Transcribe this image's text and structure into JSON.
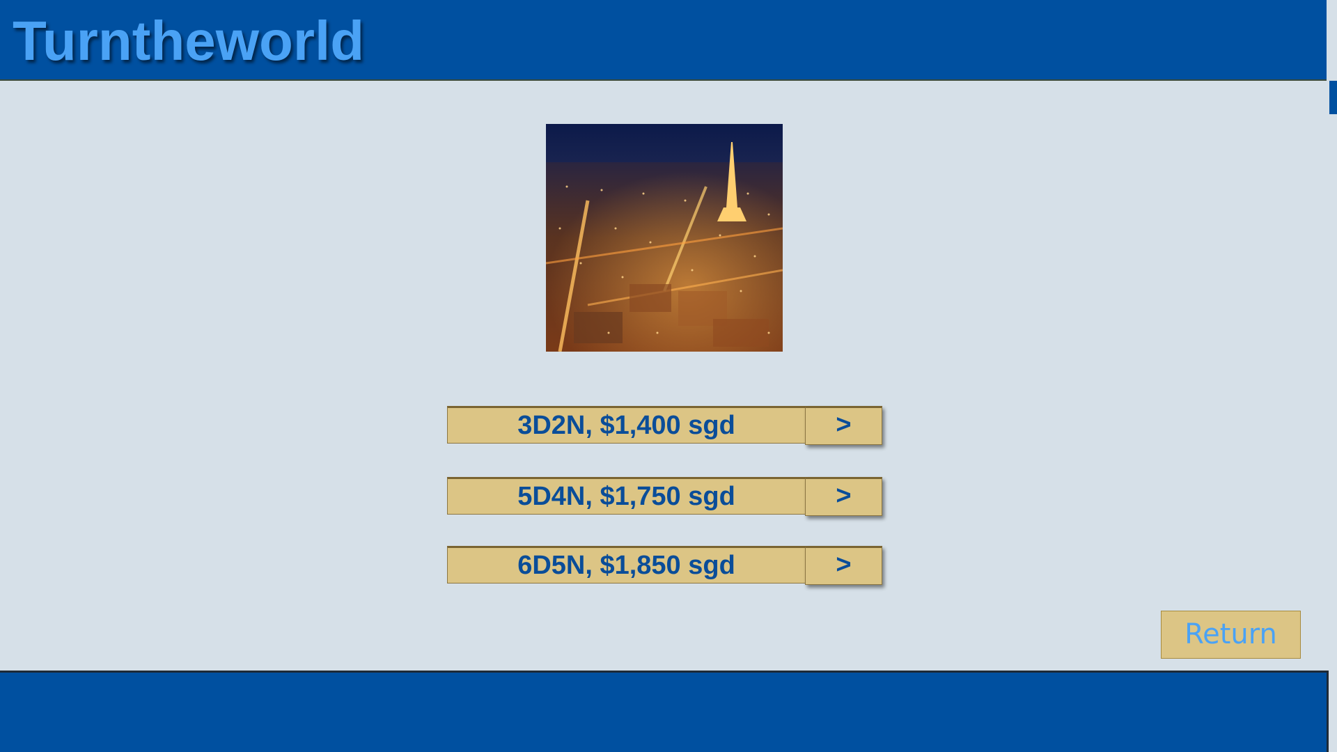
{
  "app": {
    "title": "Turntheworld"
  },
  "hero_image": {
    "name": "paris-night-eiffel-tower"
  },
  "packages": [
    {
      "label": "3D2N, $1,400 sgd",
      "arrow": ">"
    },
    {
      "label": "5D4N, $1,750 sgd",
      "arrow": ">"
    },
    {
      "label": "6D5N, $1,850 sgd",
      "arrow": ">"
    }
  ],
  "actions": {
    "return_label": "Return"
  },
  "colors": {
    "brand_blue": "#0050a0",
    "title_blue": "#4aa2f5",
    "button_gold": "#dcc585",
    "page_bg": "#d6e0e8",
    "label_text": "#0a4d99"
  }
}
